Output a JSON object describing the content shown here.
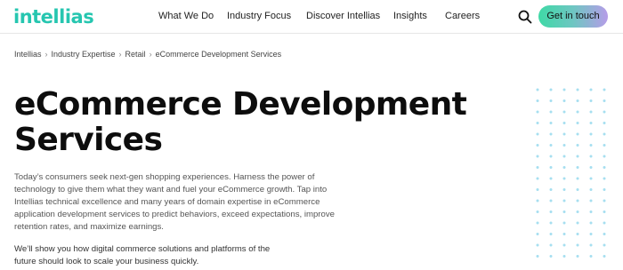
{
  "header": {
    "logo": "intellias",
    "nav": [
      "What We Do",
      "Industry Focus",
      "Discover Intellias",
      "Insights",
      "Careers"
    ],
    "search_icon": "search-icon",
    "cta_label": "Get in touch"
  },
  "breadcrumb": [
    "Intellias",
    "Industry Expertise",
    "Retail",
    "eCommerce Development Services"
  ],
  "hero": {
    "title_line1": "eCommerce Development",
    "title_line2": "Services",
    "description": "Today’s consumers seek next-gen shopping experiences. Harness the power of technology to give them what they want and fuel your eCommerce growth. Tap into Intellias technical excellence and many years of domain expertise in eCommerce application development services to predict behaviors, exceed expectations, improve retention rates, and maximize earnings.",
    "description2": "We’ll show you how digital commerce solutions and platforms of the future should look to scale your business quickly."
  },
  "colors": {
    "brand": "#26c6b0",
    "dots": "#a6dff0",
    "cta_gradient": [
      "#3fd9a6",
      "#b69ce8"
    ]
  }
}
